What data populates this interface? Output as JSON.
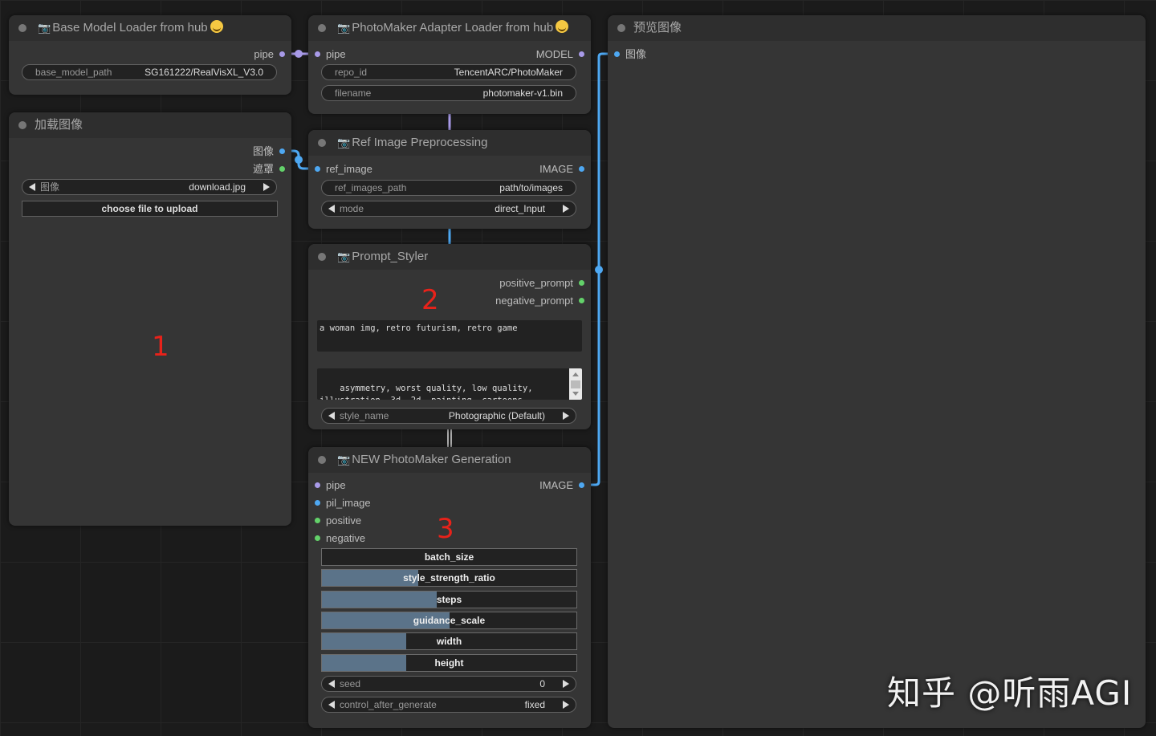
{
  "nodes": {
    "base_loader": {
      "title": "Base Model Loader from hub",
      "output_pipe": "pipe",
      "widget_label": "base_model_path",
      "widget_value": "SG161222/RealVisXL_V3.0"
    },
    "load_image": {
      "title": "加载图像",
      "output_image": "图像",
      "output_mask": "遮罩",
      "combo_label": "图像",
      "combo_value": "download.jpg",
      "upload_button": "choose file to upload",
      "marker": "1"
    },
    "adapter_loader": {
      "title": "PhotoMaker Adapter Loader from hub",
      "input_pipe": "pipe",
      "output_model": "MODEL",
      "repo_label": "repo_id",
      "repo_value": "TencentARC/PhotoMaker",
      "filename_label": "filename",
      "filename_value": "photomaker-v1.bin"
    },
    "ref_image": {
      "title": "Ref Image Preprocessing",
      "input_ref": "ref_image",
      "output_image": "IMAGE",
      "path_label": "ref_images_path",
      "path_value": "path/to/images",
      "mode_label": "mode",
      "mode_value": "direct_Input"
    },
    "prompt_styler": {
      "title": "Prompt_Styler",
      "output_positive": "positive_prompt",
      "output_negative": "negative_prompt",
      "marker": "2",
      "positive_text": "a woman img, retro futurism, retro game",
      "negative_text": "asymmetry, worst quality, low quality, illustration, 3d, 2d, painting, cartoons, sketch), open mouth",
      "style_label": "style_name",
      "style_value": "Photographic (Default)"
    },
    "generation": {
      "title": "NEW PhotoMaker Generation",
      "input_pipe": "pipe",
      "input_pil": "pil_image",
      "input_positive": "positive",
      "input_negative": "negative",
      "output_image": "IMAGE",
      "marker": "3",
      "sliders": [
        {
          "label": "batch_size",
          "level": 0.0
        },
        {
          "label": "style_strength_ratio",
          "level": 0.38
        },
        {
          "label": "steps",
          "level": 0.45
        },
        {
          "label": "guidance_scale",
          "level": 0.5
        },
        {
          "label": "width",
          "level": 0.33
        },
        {
          "label": "height",
          "level": 0.33
        }
      ],
      "seed_label": "seed",
      "seed_value": "0",
      "control_label": "control_after_generate",
      "control_value": "fixed"
    },
    "preview": {
      "title": "预览图像",
      "input_image": "图像"
    }
  },
  "watermark": "知乎 @听雨AGI",
  "colors": {
    "image_link": "#4ea8f2",
    "pipe_link": "#a89ae8",
    "prompt_link": "#63d26a",
    "marker": "#e8221a"
  }
}
